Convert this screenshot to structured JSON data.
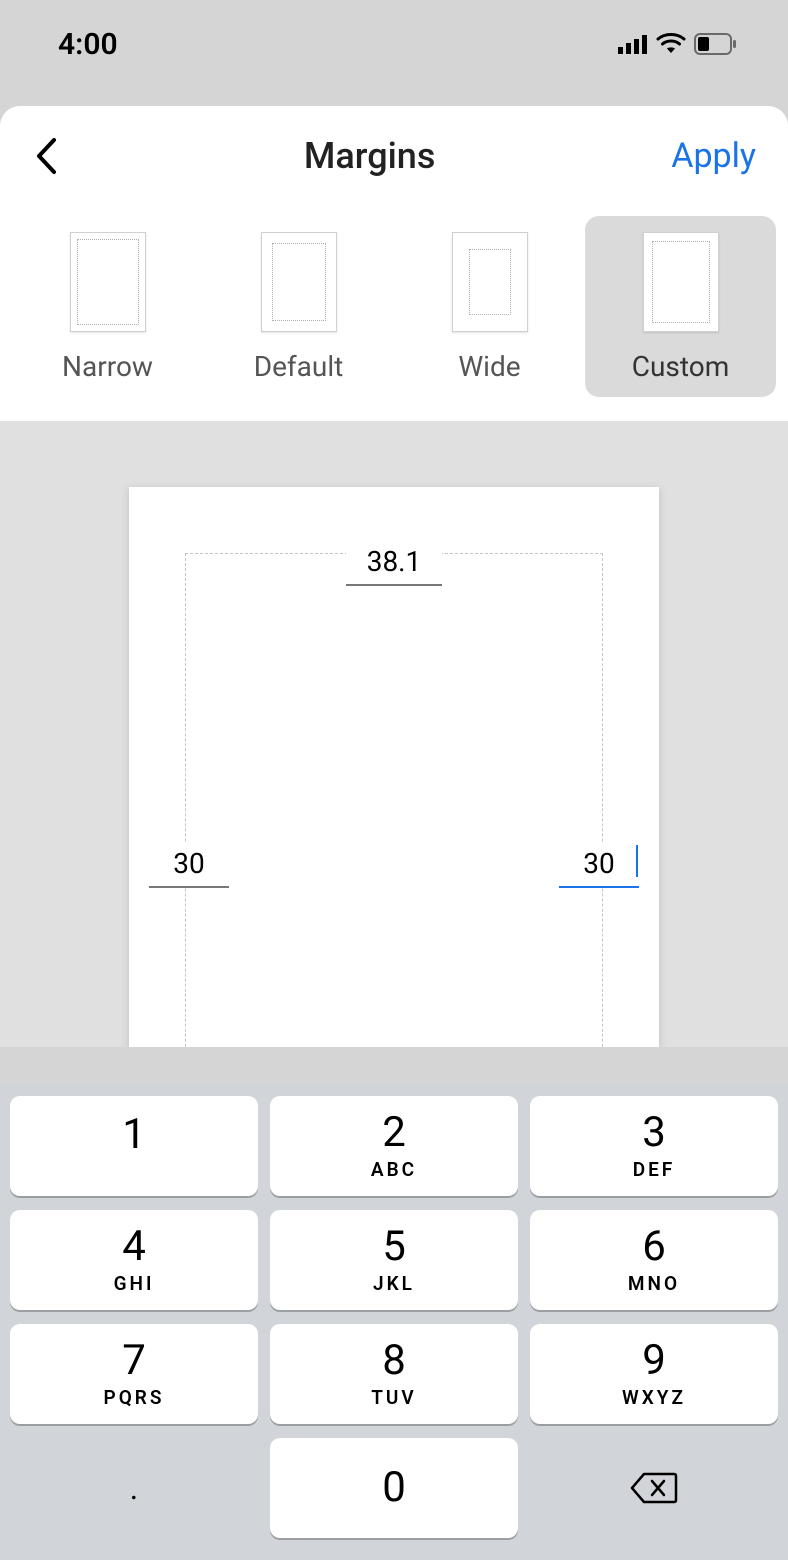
{
  "status": {
    "time": "4:00"
  },
  "header": {
    "title": "Margins",
    "apply_label": "Apply"
  },
  "presets": {
    "narrow": "Narrow",
    "default": "Default",
    "wide": "Wide",
    "custom": "Custom"
  },
  "margins": {
    "top": "38.1",
    "left": "30",
    "right": "30"
  },
  "keyboard": {
    "keys": [
      {
        "digit": "1",
        "sub": ""
      },
      {
        "digit": "2",
        "sub": "ABC"
      },
      {
        "digit": "3",
        "sub": "DEF"
      },
      {
        "digit": "4",
        "sub": "GHI"
      },
      {
        "digit": "5",
        "sub": "JKL"
      },
      {
        "digit": "6",
        "sub": "MNO"
      },
      {
        "digit": "7",
        "sub": "PQRS"
      },
      {
        "digit": "8",
        "sub": "TUV"
      },
      {
        "digit": "9",
        "sub": "WXYZ"
      }
    ],
    "period": ".",
    "zero": "0"
  }
}
